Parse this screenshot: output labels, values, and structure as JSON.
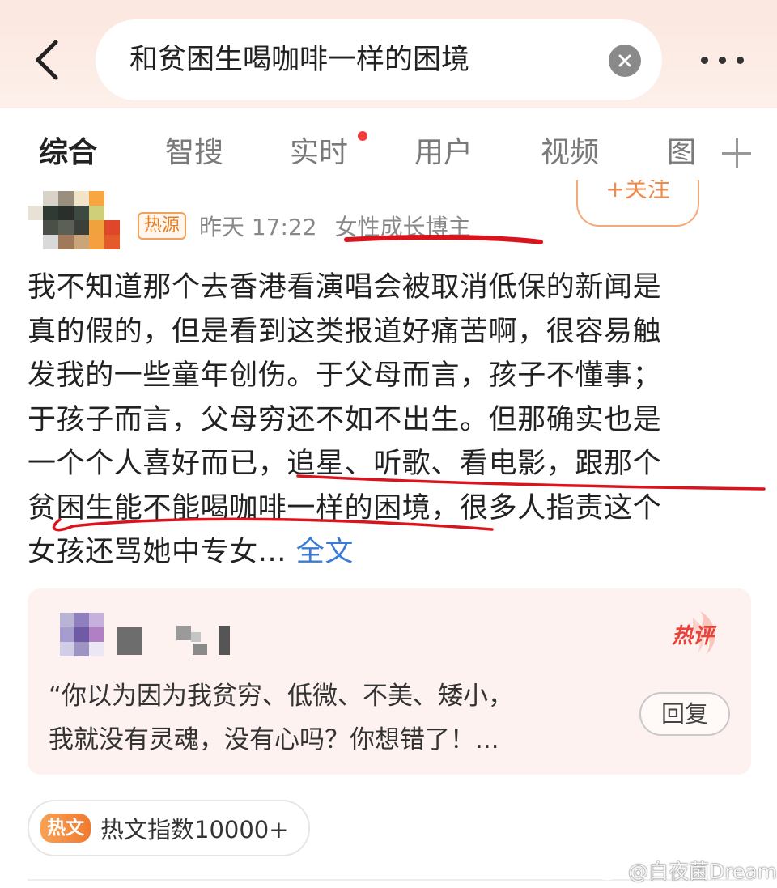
{
  "header": {
    "search_query": "和贫困生喝咖啡一样的困境"
  },
  "tabs": [
    {
      "label": "综合",
      "active": true
    },
    {
      "label": "智搜",
      "active": false
    },
    {
      "label": "实时",
      "active": false,
      "has_dot": true
    },
    {
      "label": "用户",
      "active": false
    },
    {
      "label": "视频",
      "active": false
    },
    {
      "label": "图",
      "active": false
    }
  ],
  "post": {
    "follow_label": "+关注",
    "source_badge": "热源",
    "time": "昨天 17:22",
    "author_tag": "女性成长博主",
    "lines": [
      "我不知道那个去香港看演唱会被取消低保的新闻是",
      "真的假的，但是看到这类报道好痛苦啊，很容易触",
      "发我的一些童年创伤。于父母而言，孩子不懂事；",
      "于孩子而言，父母穷还不如不出生。但那确实也是",
      "一个个人喜好而已，追星、听歌、看电影，跟那个",
      "贫困生能不能喝咖啡一样的困境，很多人指责这个"
    ],
    "last_line": "女孩还骂她中专女...",
    "full_text_link": "全文"
  },
  "hot_comment": {
    "badge": "热评",
    "lines": [
      "“你以为因为我贫穷、低微、不美、矮小，",
      "我就没有灵魂，没有心吗？你想错了！..."
    ],
    "reply_label": "回复"
  },
  "hot_index": {
    "badge": "热文",
    "text": "热文指数10000+"
  },
  "watermark": {
    "text": "@白夜菌Dream"
  },
  "colors": {
    "header_bg": "#fbe7df",
    "accent_orange": "#f08a4b",
    "link_blue": "#3a7bd5",
    "ink_red": "#d9141c",
    "notification_dot": "#f23b3b",
    "hot_comment_red": "#e8443a"
  }
}
